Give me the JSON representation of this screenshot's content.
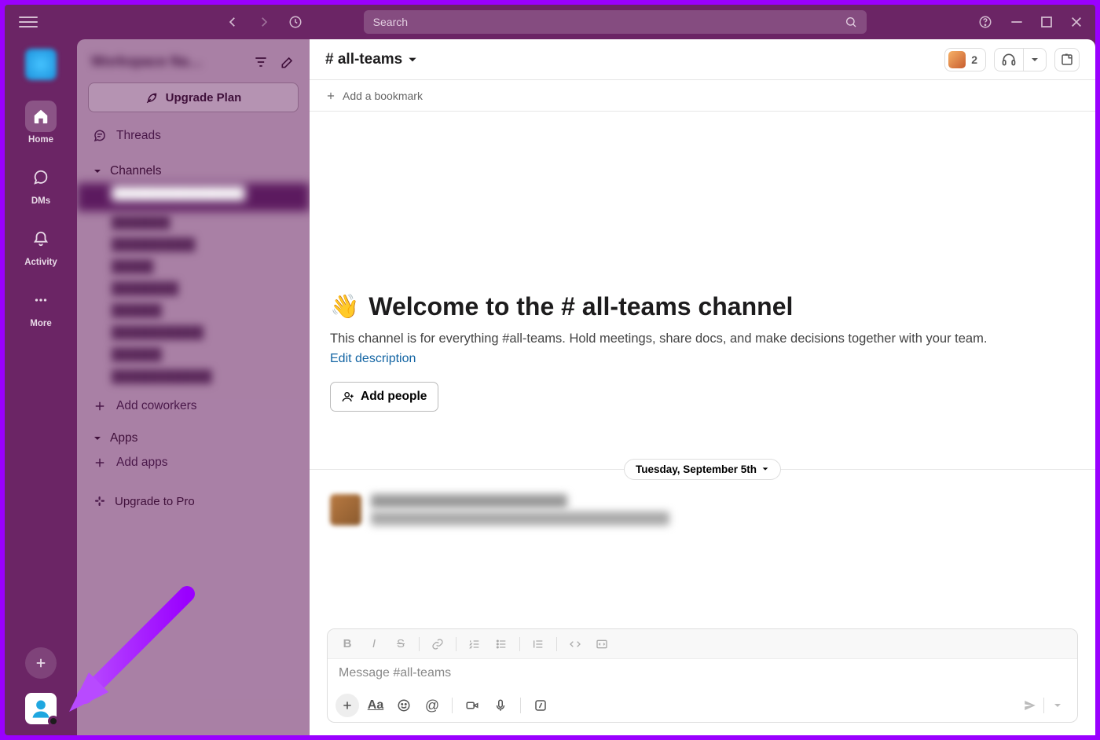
{
  "titlebar": {
    "search_placeholder": "Search"
  },
  "rail": {
    "items": [
      {
        "label": "Home"
      },
      {
        "label": "DMs"
      },
      {
        "label": "Activity"
      },
      {
        "label": "More"
      }
    ]
  },
  "sidebar": {
    "upgrade_label": "Upgrade Plan",
    "threads_label": "Threads",
    "channels_label": "Channels",
    "add_coworkers_label": "Add coworkers",
    "apps_label": "Apps",
    "add_apps_label": "Add apps",
    "upgrade_pro_label": "Upgrade to Pro"
  },
  "channel": {
    "name": "# all-teams",
    "member_count": "2",
    "add_bookmark_label": "Add a bookmark",
    "welcome_prefix": "Welcome to the ",
    "welcome_hash": "#",
    "welcome_channel": "all-teams channel",
    "description": "This channel is for everything #all-teams. Hold meetings, share docs, and make decisions together with your team.",
    "edit_description_label": "Edit description",
    "add_people_label": "Add people",
    "date_divider": "Tuesday, September 5th"
  },
  "composer": {
    "placeholder": "Message #all-teams",
    "format_aa": "Aa"
  }
}
